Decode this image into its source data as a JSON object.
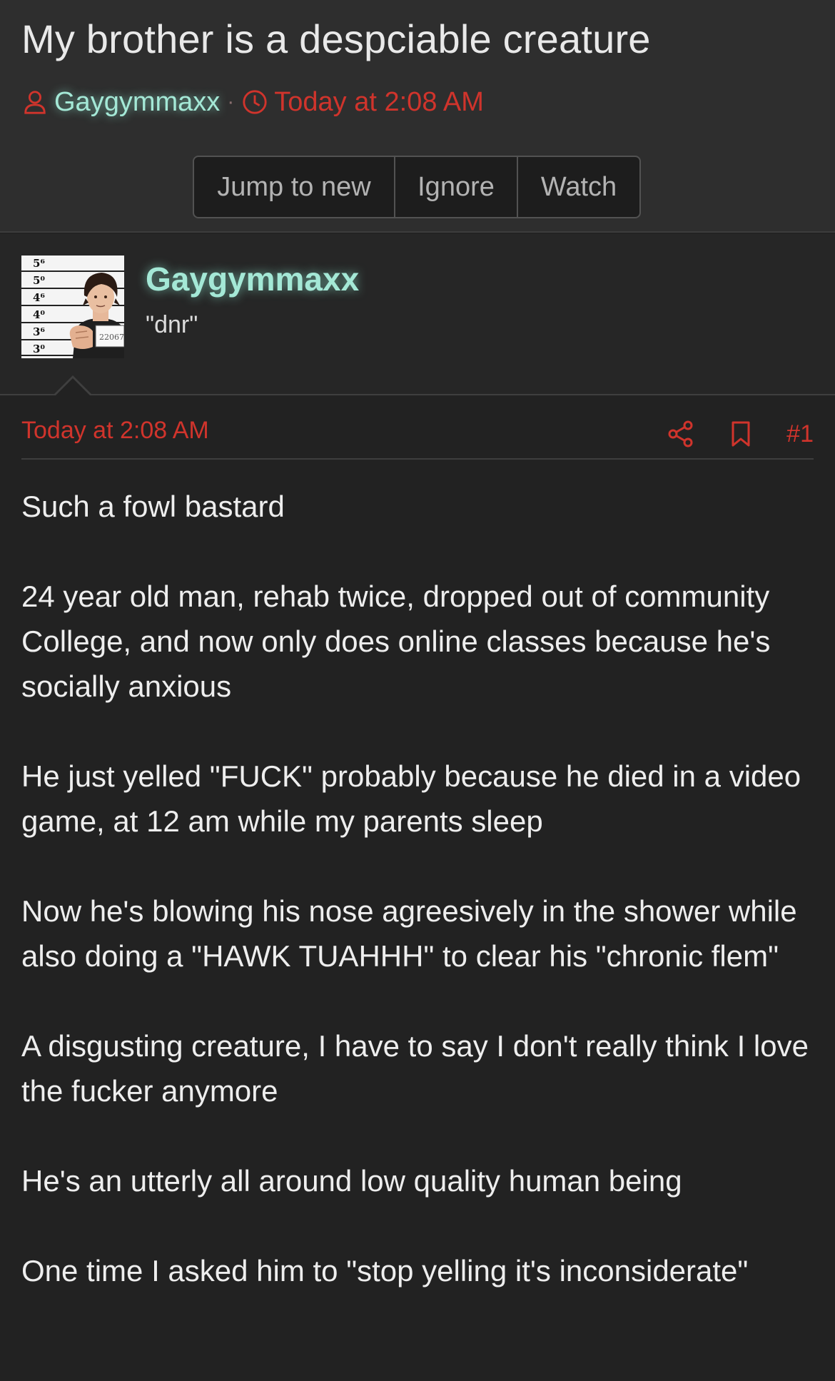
{
  "thread": {
    "title": "My brother is a despciable creature",
    "author": "Gaygymmaxx",
    "separator": "·",
    "date": "Today at 2:08 AM"
  },
  "actions": {
    "jump_label": "Jump to new",
    "ignore_label": "Ignore",
    "watch_label": "Watch"
  },
  "user": {
    "name": "Gaygymmaxx",
    "title": "\"dnr\""
  },
  "post": {
    "date": "Today at 2:08 AM",
    "number": "#1",
    "paragraphs": [
      "Such a fowl bastard",
      "24 year old man, rehab twice, dropped out of community College, and now only does online classes because he's socially anxious",
      "He just yelled \"FUCK\" probably because he died in a video game, at 12 am while my parents sleep",
      "Now he's blowing his nose agreesively in the shower while also doing a \"HAWK TUAHHH\" to clear his \"chronic flem\"",
      "A disgusting creature, I have to say I don't really think I love the fucker anymore",
      "He's an utterly all around low quality human being",
      "One time I asked him to \"stop yelling it's inconsiderate\""
    ]
  },
  "avatar": {
    "height_marks": [
      "5⁶",
      "5⁰",
      "4⁶",
      "4⁰",
      "3⁶",
      "3⁰"
    ],
    "placard": "22067"
  },
  "icons": {
    "author": "user-icon",
    "date": "clock-icon",
    "share": "share-icon",
    "bookmark": "bookmark-icon"
  },
  "colors": {
    "accent": "#d0342c",
    "username": "#a4e8d6",
    "background": "#222222",
    "header_background": "#2e2e2e"
  }
}
